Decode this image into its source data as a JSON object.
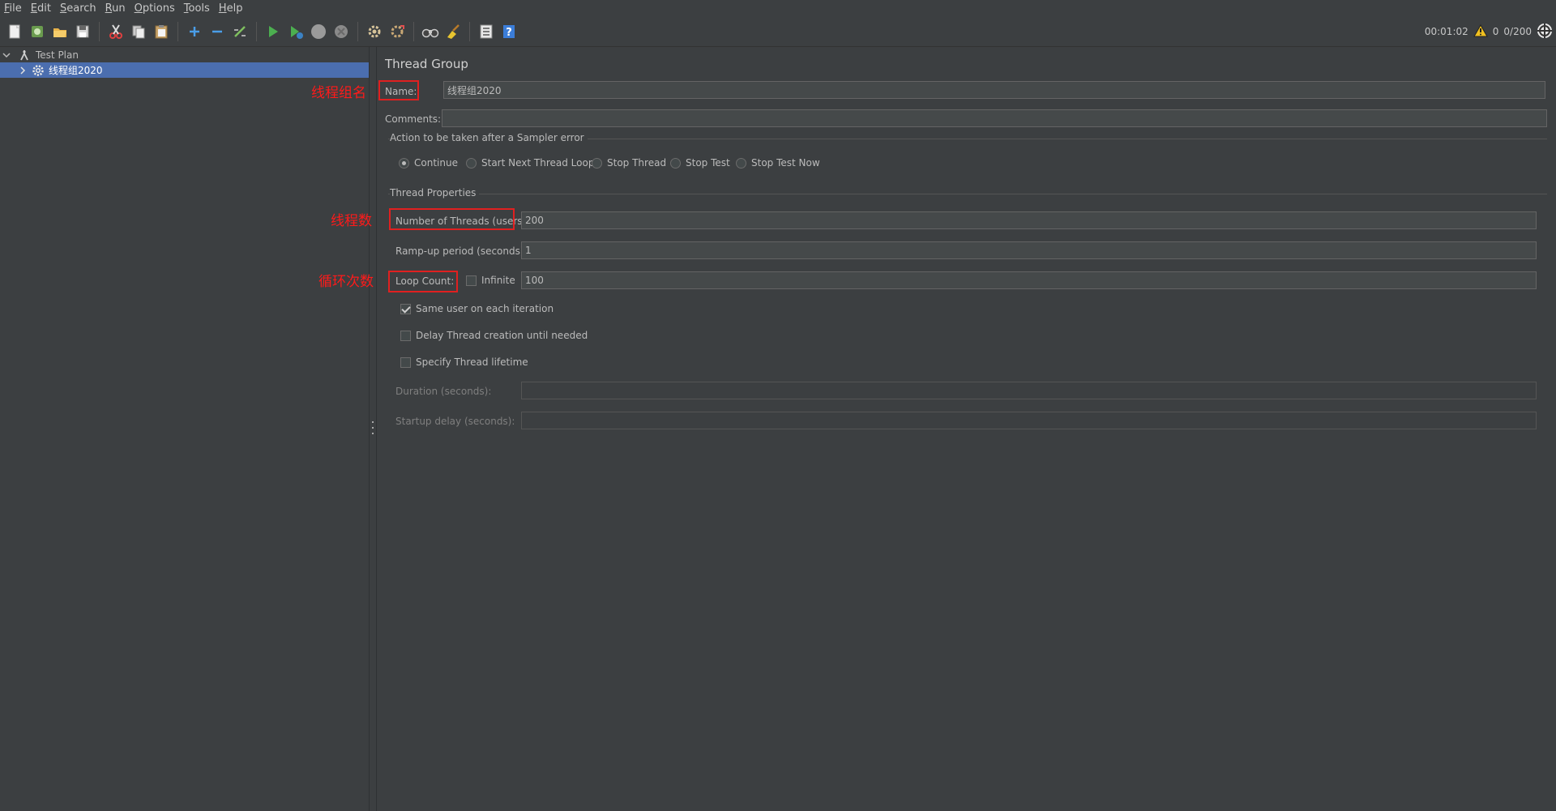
{
  "menu": [
    "File",
    "Edit",
    "Search",
    "Run",
    "Options",
    "Tools",
    "Help"
  ],
  "toolbar": {
    "timer": "00:01:02",
    "warning_count": "0",
    "threads_active": "0/200"
  },
  "tree": {
    "root_label": "Test Plan",
    "child_label": "线程组2020"
  },
  "panel": {
    "title": "Thread Group",
    "name_label": "Name:",
    "name_value": "线程组2020",
    "comments_label": "Comments:",
    "comments_value": "",
    "sampler_error": {
      "title": "Action to be taken after a Sampler error",
      "options": [
        "Continue",
        "Start Next Thread Loop",
        "Stop Thread",
        "Stop Test",
        "Stop Test Now"
      ],
      "selected": "Continue"
    },
    "thread_props": {
      "title": "Thread Properties",
      "threads_label": "Number of Threads (users):",
      "threads_value": "200",
      "rampup_label": "Ramp-up period (seconds):",
      "rampup_value": "1",
      "loop_label": "Loop Count:",
      "infinite_label": "Infinite",
      "infinite_checked": false,
      "loop_value": "100",
      "same_user_label": "Same user on each iteration",
      "same_user_checked": true,
      "delay_label": "Delay Thread creation until needed",
      "delay_checked": false,
      "lifetime_label": "Specify Thread lifetime",
      "lifetime_checked": false,
      "duration_label": "Duration (seconds):",
      "duration_value": "",
      "startup_label": "Startup delay (seconds):",
      "startup_value": ""
    }
  },
  "annotations": {
    "name": "线程组名",
    "threads": "线程数",
    "loop": "循环次数"
  },
  "colors": {
    "background": "#3c3f41",
    "selection": "#4b6eaf",
    "annotation": "#e02020"
  }
}
